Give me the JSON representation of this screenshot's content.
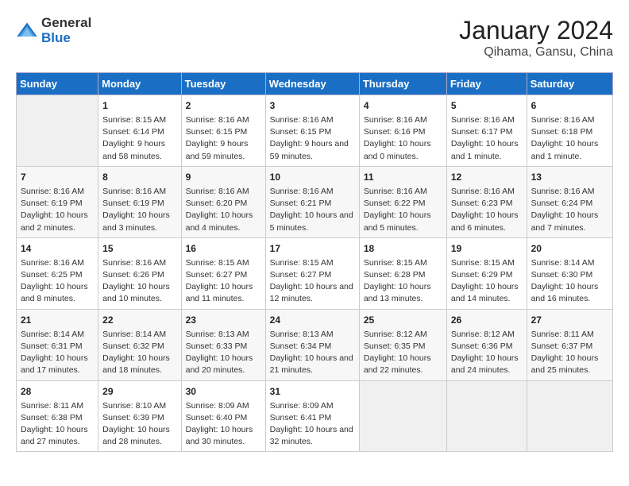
{
  "header": {
    "logo_line1": "General",
    "logo_line2": "Blue",
    "title": "January 2024",
    "subtitle": "Qihama, Gansu, China"
  },
  "days_of_week": [
    "Sunday",
    "Monday",
    "Tuesday",
    "Wednesday",
    "Thursday",
    "Friday",
    "Saturday"
  ],
  "weeks": [
    [
      {
        "day": "",
        "sunrise": "",
        "sunset": "",
        "daylight": ""
      },
      {
        "day": "1",
        "sunrise": "Sunrise: 8:15 AM",
        "sunset": "Sunset: 6:14 PM",
        "daylight": "Daylight: 9 hours and 58 minutes."
      },
      {
        "day": "2",
        "sunrise": "Sunrise: 8:16 AM",
        "sunset": "Sunset: 6:15 PM",
        "daylight": "Daylight: 9 hours and 59 minutes."
      },
      {
        "day": "3",
        "sunrise": "Sunrise: 8:16 AM",
        "sunset": "Sunset: 6:15 PM",
        "daylight": "Daylight: 9 hours and 59 minutes."
      },
      {
        "day": "4",
        "sunrise": "Sunrise: 8:16 AM",
        "sunset": "Sunset: 6:16 PM",
        "daylight": "Daylight: 10 hours and 0 minutes."
      },
      {
        "day": "5",
        "sunrise": "Sunrise: 8:16 AM",
        "sunset": "Sunset: 6:17 PM",
        "daylight": "Daylight: 10 hours and 1 minute."
      },
      {
        "day": "6",
        "sunrise": "Sunrise: 8:16 AM",
        "sunset": "Sunset: 6:18 PM",
        "daylight": "Daylight: 10 hours and 1 minute."
      }
    ],
    [
      {
        "day": "7",
        "sunrise": "Sunrise: 8:16 AM",
        "sunset": "Sunset: 6:19 PM",
        "daylight": "Daylight: 10 hours and 2 minutes."
      },
      {
        "day": "8",
        "sunrise": "Sunrise: 8:16 AM",
        "sunset": "Sunset: 6:19 PM",
        "daylight": "Daylight: 10 hours and 3 minutes."
      },
      {
        "day": "9",
        "sunrise": "Sunrise: 8:16 AM",
        "sunset": "Sunset: 6:20 PM",
        "daylight": "Daylight: 10 hours and 4 minutes."
      },
      {
        "day": "10",
        "sunrise": "Sunrise: 8:16 AM",
        "sunset": "Sunset: 6:21 PM",
        "daylight": "Daylight: 10 hours and 5 minutes."
      },
      {
        "day": "11",
        "sunrise": "Sunrise: 8:16 AM",
        "sunset": "Sunset: 6:22 PM",
        "daylight": "Daylight: 10 hours and 5 minutes."
      },
      {
        "day": "12",
        "sunrise": "Sunrise: 8:16 AM",
        "sunset": "Sunset: 6:23 PM",
        "daylight": "Daylight: 10 hours and 6 minutes."
      },
      {
        "day": "13",
        "sunrise": "Sunrise: 8:16 AM",
        "sunset": "Sunset: 6:24 PM",
        "daylight": "Daylight: 10 hours and 7 minutes."
      }
    ],
    [
      {
        "day": "14",
        "sunrise": "Sunrise: 8:16 AM",
        "sunset": "Sunset: 6:25 PM",
        "daylight": "Daylight: 10 hours and 8 minutes."
      },
      {
        "day": "15",
        "sunrise": "Sunrise: 8:16 AM",
        "sunset": "Sunset: 6:26 PM",
        "daylight": "Daylight: 10 hours and 10 minutes."
      },
      {
        "day": "16",
        "sunrise": "Sunrise: 8:15 AM",
        "sunset": "Sunset: 6:27 PM",
        "daylight": "Daylight: 10 hours and 11 minutes."
      },
      {
        "day": "17",
        "sunrise": "Sunrise: 8:15 AM",
        "sunset": "Sunset: 6:27 PM",
        "daylight": "Daylight: 10 hours and 12 minutes."
      },
      {
        "day": "18",
        "sunrise": "Sunrise: 8:15 AM",
        "sunset": "Sunset: 6:28 PM",
        "daylight": "Daylight: 10 hours and 13 minutes."
      },
      {
        "day": "19",
        "sunrise": "Sunrise: 8:15 AM",
        "sunset": "Sunset: 6:29 PM",
        "daylight": "Daylight: 10 hours and 14 minutes."
      },
      {
        "day": "20",
        "sunrise": "Sunrise: 8:14 AM",
        "sunset": "Sunset: 6:30 PM",
        "daylight": "Daylight: 10 hours and 16 minutes."
      }
    ],
    [
      {
        "day": "21",
        "sunrise": "Sunrise: 8:14 AM",
        "sunset": "Sunset: 6:31 PM",
        "daylight": "Daylight: 10 hours and 17 minutes."
      },
      {
        "day": "22",
        "sunrise": "Sunrise: 8:14 AM",
        "sunset": "Sunset: 6:32 PM",
        "daylight": "Daylight: 10 hours and 18 minutes."
      },
      {
        "day": "23",
        "sunrise": "Sunrise: 8:13 AM",
        "sunset": "Sunset: 6:33 PM",
        "daylight": "Daylight: 10 hours and 20 minutes."
      },
      {
        "day": "24",
        "sunrise": "Sunrise: 8:13 AM",
        "sunset": "Sunset: 6:34 PM",
        "daylight": "Daylight: 10 hours and 21 minutes."
      },
      {
        "day": "25",
        "sunrise": "Sunrise: 8:12 AM",
        "sunset": "Sunset: 6:35 PM",
        "daylight": "Daylight: 10 hours and 22 minutes."
      },
      {
        "day": "26",
        "sunrise": "Sunrise: 8:12 AM",
        "sunset": "Sunset: 6:36 PM",
        "daylight": "Daylight: 10 hours and 24 minutes."
      },
      {
        "day": "27",
        "sunrise": "Sunrise: 8:11 AM",
        "sunset": "Sunset: 6:37 PM",
        "daylight": "Daylight: 10 hours and 25 minutes."
      }
    ],
    [
      {
        "day": "28",
        "sunrise": "Sunrise: 8:11 AM",
        "sunset": "Sunset: 6:38 PM",
        "daylight": "Daylight: 10 hours and 27 minutes."
      },
      {
        "day": "29",
        "sunrise": "Sunrise: 8:10 AM",
        "sunset": "Sunset: 6:39 PM",
        "daylight": "Daylight: 10 hours and 28 minutes."
      },
      {
        "day": "30",
        "sunrise": "Sunrise: 8:09 AM",
        "sunset": "Sunset: 6:40 PM",
        "daylight": "Daylight: 10 hours and 30 minutes."
      },
      {
        "day": "31",
        "sunrise": "Sunrise: 8:09 AM",
        "sunset": "Sunset: 6:41 PM",
        "daylight": "Daylight: 10 hours and 32 minutes."
      },
      {
        "day": "",
        "sunrise": "",
        "sunset": "",
        "daylight": ""
      },
      {
        "day": "",
        "sunrise": "",
        "sunset": "",
        "daylight": ""
      },
      {
        "day": "",
        "sunrise": "",
        "sunset": "",
        "daylight": ""
      }
    ]
  ]
}
